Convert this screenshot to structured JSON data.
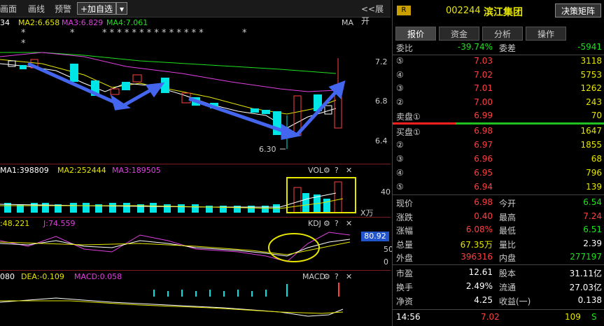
{
  "toolbar": {
    "item1": "画面",
    "item2": "画线",
    "item3": "预警",
    "add_watch": "+加自选",
    "expand": "<<展开"
  },
  "ma": {
    "ma1_prefix": "34",
    "ma2": "MA2:6.658",
    "ma3": "MA3:6.829",
    "ma4": "MA4:7.061",
    "label": "MA",
    "stars1": "* *",
    "stars2": "*",
    "stars3": "* * * * * * * * * * * * * *",
    "stars4": "*"
  },
  "price_axis": [
    "7.2",
    "6.8",
    "6.4"
  ],
  "low_mark": "6.30",
  "vol": {
    "ma1": "MA1:398809",
    "ma2": "MA2:252444",
    "ma3": "MA3:189505",
    "label": "VOL",
    "axis": "40",
    "unit": "X万"
  },
  "kdj": {
    "d": ":48.221",
    "j": "J:74.559",
    "label": "KDJ",
    "axis_top": "80.92",
    "axis_mid": "50",
    "axis_bot": "0"
  },
  "macd": {
    "dif": "080",
    "dea": "DEA:-0.109",
    "macd": "MACD:0.058",
    "label": "MACD"
  },
  "colors": {
    "red": "#ff4040",
    "green": "#20e020",
    "cyan": "#00e5e5",
    "yellow": "#e6e600",
    "magenta": "#e040e0",
    "blue": "#4466ee"
  },
  "stock": {
    "badge": "R",
    "code": "002244",
    "name": "滨江集团",
    "button": "决策矩阵"
  },
  "tabs": [
    "报价",
    "资金",
    "分析",
    "操作"
  ],
  "ratio": {
    "label": "委比",
    "value": "-39.74%",
    "diff_label": "委差",
    "diff": "-5941"
  },
  "sell": [
    {
      "n": "⑤",
      "p": "7.03",
      "v": "3118"
    },
    {
      "n": "④",
      "p": "7.02",
      "v": "5753"
    },
    {
      "n": "③",
      "p": "7.01",
      "v": "1262"
    },
    {
      "n": "②",
      "p": "7.00",
      "v": "243"
    },
    {
      "n": "卖盘①",
      "p": "6.99",
      "v": "70"
    }
  ],
  "buy": [
    {
      "n": "买盘①",
      "p": "6.98",
      "v": "1647"
    },
    {
      "n": "②",
      "p": "6.97",
      "v": "1855"
    },
    {
      "n": "③",
      "p": "6.96",
      "v": "68"
    },
    {
      "n": "④",
      "p": "6.95",
      "v": "796"
    },
    {
      "n": "⑤",
      "p": "6.94",
      "v": "139"
    }
  ],
  "stats": [
    {
      "l1": "现价",
      "v1": "6.98",
      "c1": "red",
      "l2": "今开",
      "v2": "6.54",
      "c2": "green"
    },
    {
      "l1": "涨跌",
      "v1": "0.40",
      "c1": "red",
      "l2": "最高",
      "v2": "7.24",
      "c2": "red"
    },
    {
      "l1": "涨幅",
      "v1": "6.08%",
      "c1": "red",
      "l2": "最低",
      "v2": "6.51",
      "c2": "green"
    },
    {
      "l1": "总量",
      "v1": "67.35万",
      "c1": "yellow",
      "l2": "量比",
      "v2": "2.39",
      "c2": "white"
    },
    {
      "l1": "外盘",
      "v1": "396316",
      "c1": "red",
      "l2": "内盘",
      "v2": "277197",
      "c2": "green"
    }
  ],
  "stats2": [
    {
      "l1": "市盈",
      "v1": "12.61",
      "l2": "股本",
      "v2": "31.11亿"
    },
    {
      "l1": "换手",
      "v1": "2.49%",
      "l2": "流通",
      "v2": "27.03亿"
    },
    {
      "l1": "净资",
      "v1": "4.25",
      "l2": "收益(一)",
      "v2": "0.138"
    }
  ],
  "tick": {
    "time": "14:56",
    "price": "7.02",
    "vol": "109",
    "flag": "S"
  }
}
